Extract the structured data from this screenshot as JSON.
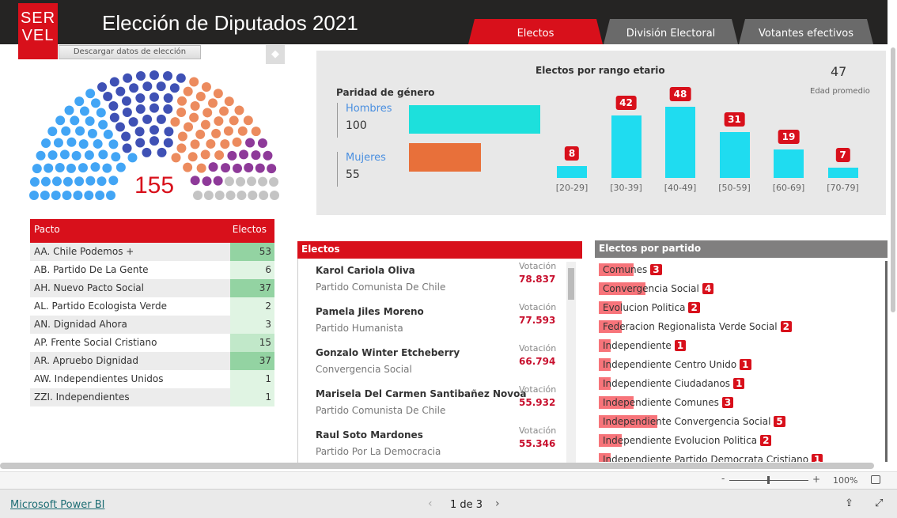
{
  "header": {
    "logo": "SER VEL",
    "title": "Elección de Diputados 2021",
    "tabs": [
      "Electos",
      "División Electoral",
      "Votantes efectivos"
    ],
    "download": "Descargar datos de elección"
  },
  "colors": {
    "accent": "#d8101b",
    "parliament": [
      "#42a5f5",
      "#3f51b5",
      "#ec8b5e",
      "#8e3a99",
      "#c4c4c4"
    ],
    "age_bar": "#1fdcf0",
    "men_bar": "#1de0dc",
    "women_bar": "#e8703a"
  },
  "parliament": {
    "total": "155",
    "groups": [
      53,
      37,
      37,
      15,
      13
    ]
  },
  "pacto": {
    "header": "Pacto",
    "value_header": "Electos",
    "rows": [
      {
        "name": "AA. Chile Podemos +",
        "value": "53"
      },
      {
        "name": "AB. Partido De La Gente",
        "value": "6"
      },
      {
        "name": "AH. Nuevo Pacto Social",
        "value": "37"
      },
      {
        "name": "AL. Partido Ecologista Verde",
        "value": "2"
      },
      {
        "name": "AN. Dignidad Ahora",
        "value": "3"
      },
      {
        "name": "AP. Frente Social Cristiano",
        "value": "15"
      },
      {
        "name": "AR. Apruebo Dignidad",
        "value": "37"
      },
      {
        "name": "AW. Independientes Unidos",
        "value": "1"
      },
      {
        "name": "ZZI. Independientes",
        "value": "1"
      }
    ]
  },
  "gender": {
    "title": "Paridad de género",
    "men_label": "Hombres",
    "men": "100",
    "women_label": "Mujeres",
    "women": "55"
  },
  "age": {
    "title": "Electos por rango etario",
    "avg": "47",
    "avg_label": "Edad promedio",
    "chart_data": {
      "type": "bar",
      "categories": [
        "[20-29]",
        "[30-39]",
        "[40-49]",
        "[50-59]",
        "[60-69]",
        "[70-79]"
      ],
      "values": [
        8,
        42,
        48,
        31,
        19,
        7
      ]
    }
  },
  "electos": {
    "title": "Electos",
    "vote_label": "Votación",
    "rows": [
      {
        "name": "Karol Cariola Oliva",
        "party": "Partido Comunista De Chile",
        "votes": "78.837"
      },
      {
        "name": "Pamela Jiles Moreno",
        "party": "Partido Humanista",
        "votes": "77.593"
      },
      {
        "name": "Gonzalo Winter Etcheberry",
        "party": "Convergencia Social",
        "votes": "66.794"
      },
      {
        "name": "Marisela Del Carmen Santibañez Novoa",
        "party": "Partido Comunista De Chile",
        "votes": "55.932"
      },
      {
        "name": "Raul Soto Mardones",
        "party": "Partido Por La Democracia",
        "votes": "55.346"
      }
    ]
  },
  "partido": {
    "title": "Electos por partido",
    "rows": [
      {
        "name": "Comunes",
        "value": 3
      },
      {
        "name": "Convergencia Social",
        "value": 4
      },
      {
        "name": "Evolucion Politica",
        "value": 2
      },
      {
        "name": "Federacion Regionalista Verde Social",
        "value": 2
      },
      {
        "name": "Independiente",
        "value": 1
      },
      {
        "name": "Independiente Centro Unido",
        "value": 1
      },
      {
        "name": "Independiente Ciudadanos",
        "value": 1
      },
      {
        "name": "Independiente Comunes",
        "value": 3
      },
      {
        "name": "Independiente Convergencia Social",
        "value": 5
      },
      {
        "name": "Independiente Evolucion Politica",
        "value": 2
      },
      {
        "name": "Independiente Partido Democrata Cristiano",
        "value": 1
      }
    ]
  },
  "footer": {
    "zoom": "100%",
    "brand": "Microsoft Power BI",
    "page": "1 de 3"
  }
}
